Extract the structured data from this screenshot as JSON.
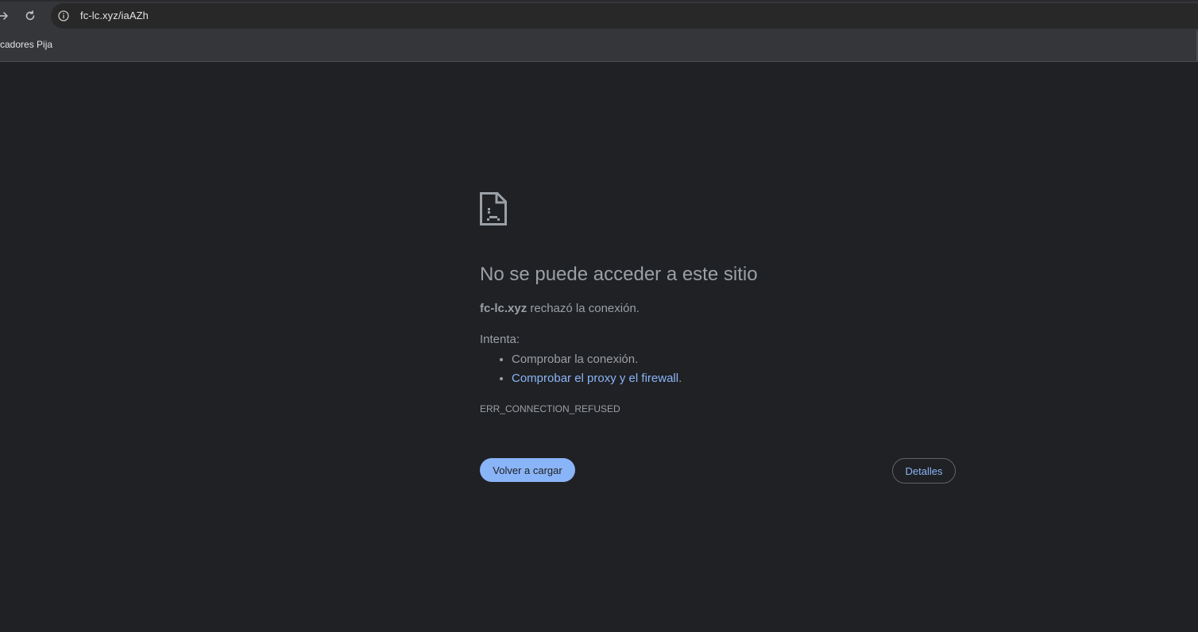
{
  "browser": {
    "url": "fc-lc.xyz/iaAZh",
    "forward_icon": "arrow-right-icon",
    "reload_icon": "reload-icon",
    "site_info_icon": "info-icon"
  },
  "bookmarks_bar": {
    "items": [
      {
        "label": "rcadores Pija"
      }
    ]
  },
  "error_page": {
    "icon": "sad-document-icon",
    "title": "No se puede acceder a este sitio",
    "host": "fc-lc.xyz",
    "description": " rechazó la conexión.",
    "try_label": "Intenta:",
    "suggestions": [
      {
        "text": "Comprobar la conexión.",
        "link": false
      },
      {
        "text": "Comprobar el proxy y el firewall",
        "suffix": ".",
        "link": true
      }
    ],
    "error_code": "ERR_CONNECTION_REFUSED",
    "reload_button": "Volver a cargar",
    "details_button": "Detalles"
  },
  "colors": {
    "background": "#202124",
    "toolbar": "#35363a",
    "text": "#9aa0a6",
    "link": "#8ab4f8",
    "primary_button": "#8ab4f8"
  }
}
